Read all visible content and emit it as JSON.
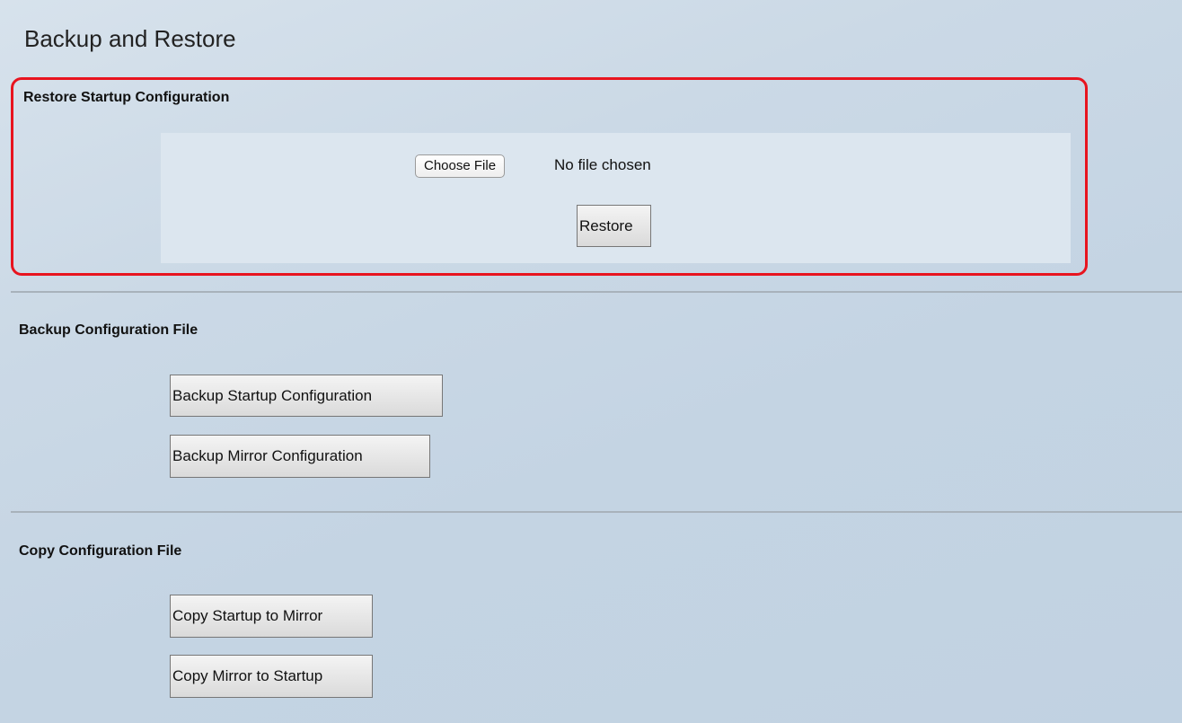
{
  "page": {
    "title": "Backup and Restore"
  },
  "restore_section": {
    "heading": "Restore Startup Configuration",
    "choose_file_label": "Choose File",
    "file_status": "No file chosen",
    "restore_label": "Restore",
    "highlight_color": "#e8141f"
  },
  "backup_section": {
    "heading": "Backup Configuration File",
    "backup_startup_label": "Backup Startup Configuration",
    "backup_mirror_label": "Backup Mirror Configuration"
  },
  "copy_section": {
    "heading": "Copy Configuration File",
    "copy_startup_to_mirror_label": "Copy Startup to Mirror",
    "copy_mirror_to_startup_label": "Copy Mirror to Startup"
  }
}
